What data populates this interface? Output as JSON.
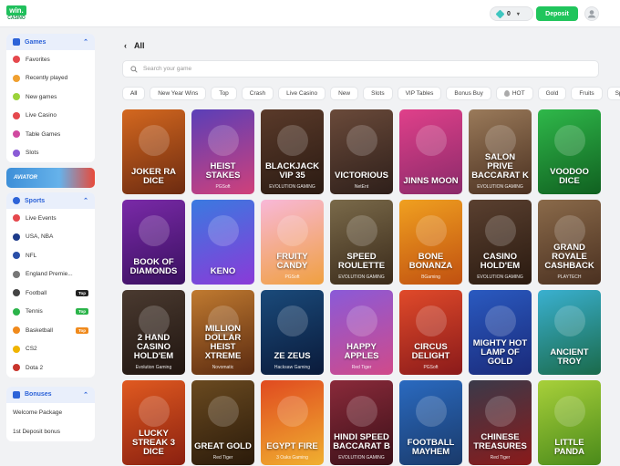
{
  "header": {
    "logo_top": "win.",
    "logo_bottom": "CASINO",
    "balance": "0",
    "deposit_label": "Deposit"
  },
  "sidebar": {
    "games_title": "Games",
    "games_items": [
      {
        "label": "Favorites",
        "icon": "heart-icon",
        "color": "#e5484d"
      },
      {
        "label": "Recently played",
        "icon": "clock-icon",
        "color": "#f0a030"
      },
      {
        "label": "New games",
        "icon": "new-icon",
        "color": "#9bd33a"
      },
      {
        "label": "Live Casino",
        "icon": "live-icon",
        "color": "#e5484d"
      },
      {
        "label": "Table Games",
        "icon": "table-icon",
        "color": "#d04aa0"
      },
      {
        "label": "Slots",
        "icon": "slots-icon",
        "color": "#8a5bd6"
      }
    ],
    "aviator_label": "AVIATOR",
    "sports_title": "Sports",
    "sports_items": [
      {
        "label": "Live Events",
        "icon": "live-icon",
        "color": "#e5484d",
        "tag": ""
      },
      {
        "label": "USA, NBA",
        "icon": "nba-icon",
        "color": "#1d3b8a",
        "tag": ""
      },
      {
        "label": "NFL",
        "icon": "nfl-icon",
        "color": "#2a4fa8",
        "tag": ""
      },
      {
        "label": "England Premie...",
        "icon": "premier-league-icon",
        "color": "#777",
        "tag": ""
      },
      {
        "label": "Football",
        "icon": "football-icon",
        "color": "#444",
        "tag": "Top"
      },
      {
        "label": "Tennis",
        "icon": "tennis-icon",
        "color": "#2bb44a",
        "tag": "Top"
      },
      {
        "label": "Basketball",
        "icon": "basketball-icon",
        "color": "#f08a1c",
        "tag": "Top"
      },
      {
        "label": "CS2",
        "icon": "cs2-icon",
        "color": "#f0b400",
        "tag": ""
      },
      {
        "label": "Dota 2",
        "icon": "dota2-icon",
        "color": "#c8342c",
        "tag": ""
      }
    ],
    "bonuses_title": "Bonuses",
    "bonus_items": [
      "Welcome Package",
      "1st Deposit bonus"
    ]
  },
  "main": {
    "title": "All",
    "search_placeholder": "Search your game",
    "chips": [
      "All",
      "New Year Wins",
      "Top",
      "Crash",
      "Live Casino",
      "New",
      "Slots",
      "VIP Tables",
      "Bonus Buy",
      "HOT",
      "Gold",
      "Fruits",
      "Sport Ga"
    ],
    "games": [
      {
        "name": "JOKER RA DICE",
        "provider": "",
        "bg": "#d4681f",
        "bg2": "#6b2a10"
      },
      {
        "name": "HEIST STAKES",
        "provider": "PGSoft",
        "bg": "#5a3fb8",
        "bg2": "#d0407a"
      },
      {
        "name": "BLACKJACK VIP 35",
        "provider": "EVOLUTION GAMING",
        "bg": "#5a3a2a",
        "bg2": "#2a1a12"
      },
      {
        "name": "VICTORIOUS",
        "provider": "NetEnt",
        "bg": "#6a4a3a",
        "bg2": "#2e1f1a"
      },
      {
        "name": "JINNS MOON",
        "provider": "",
        "bg": "#e0408a",
        "bg2": "#8a2a6a"
      },
      {
        "name": "SALON PRIVE BACCARAT K",
        "provider": "EVOLUTION GAMING",
        "bg": "#9a7a5a",
        "bg2": "#4a3020"
      },
      {
        "name": "VOODOO DICE",
        "provider": "",
        "bg": "#2fb84a",
        "bg2": "#106020"
      },
      {
        "name": "BOOK OF DIAMONDS",
        "provider": "",
        "bg": "#7a2aa8",
        "bg2": "#3a1060"
      },
      {
        "name": "KENO",
        "provider": "",
        "bg": "#3a7ae0",
        "bg2": "#8a3ad8"
      },
      {
        "name": "FRUITY CANDY",
        "provider": "PGSoft",
        "bg": "#f8b8d8",
        "bg2": "#f0a040"
      },
      {
        "name": "SPEED ROULETTE",
        "provider": "EVOLUTION GAMING",
        "bg": "#7a6a4a",
        "bg2": "#3a2a1a"
      },
      {
        "name": "BONE BONANZA",
        "provider": "BGaming",
        "bg": "#f0a020",
        "bg2": "#c05010"
      },
      {
        "name": "CASINO HOLD'EM",
        "provider": "EVOLUTION GAMING",
        "bg": "#5a4030",
        "bg2": "#2a1a10"
      },
      {
        "name": "GRAND ROYALE CASHBACK",
        "provider": "PLAYTECH",
        "bg": "#8a6a4a",
        "bg2": "#4a3020"
      },
      {
        "name": "2 HAND CASINO HOLD'EM",
        "provider": "Evolution Gaming",
        "bg": "#4a3a30",
        "bg2": "#201510"
      },
      {
        "name": "MILLION DOLLAR HEIST XTREME",
        "provider": "Novomatic",
        "bg": "#c07a30",
        "bg2": "#5a2a10"
      },
      {
        "name": "ZE ZEUS",
        "provider": "Hacksaw Gaming",
        "bg": "#1a4a7a",
        "bg2": "#0a1a3a"
      },
      {
        "name": "HAPPY APPLES",
        "provider": "Red Tiger",
        "bg": "#8a5ad8",
        "bg2": "#d04a8a"
      },
      {
        "name": "CIRCUS DELIGHT",
        "provider": "PGSoft",
        "bg": "#e04a2a",
        "bg2": "#8a1a1a"
      },
      {
        "name": "MIGHTY HOT LAMP OF GOLD",
        "provider": "",
        "bg": "#2a5ac0",
        "bg2": "#1a2a7a"
      },
      {
        "name": "ANCIENT TROY",
        "provider": "",
        "bg": "#3ab0d0",
        "bg2": "#1a6a4a"
      },
      {
        "name": "LUCKY STREAK 3 DICE",
        "provider": "",
        "bg": "#e05a20",
        "bg2": "#8a2010"
      },
      {
        "name": "GREAT GOLD",
        "provider": "Red Tiger",
        "bg": "#6a4a20",
        "bg2": "#2a1a0a"
      },
      {
        "name": "EGYPT FIRE",
        "provider": "3 Oaks Gaming",
        "bg": "#e04a20",
        "bg2": "#f0b030"
      },
      {
        "name": "HINDI SPEED BACCARAT B",
        "provider": "EVOLUTION GAMING",
        "bg": "#8a2a3a",
        "bg2": "#3a1018"
      },
      {
        "name": "FOOTBALL MAYHEM",
        "provider": "",
        "bg": "#2a6ac0",
        "bg2": "#1a3a6a"
      },
      {
        "name": "CHINESE TREASURES",
        "provider": "Red Tiger",
        "bg": "#3a3a4a",
        "bg2": "#8a1a1a"
      },
      {
        "name": "LITTLE PANDA",
        "provider": "",
        "bg": "#a8d03a",
        "bg2": "#4a8a1a"
      }
    ]
  }
}
